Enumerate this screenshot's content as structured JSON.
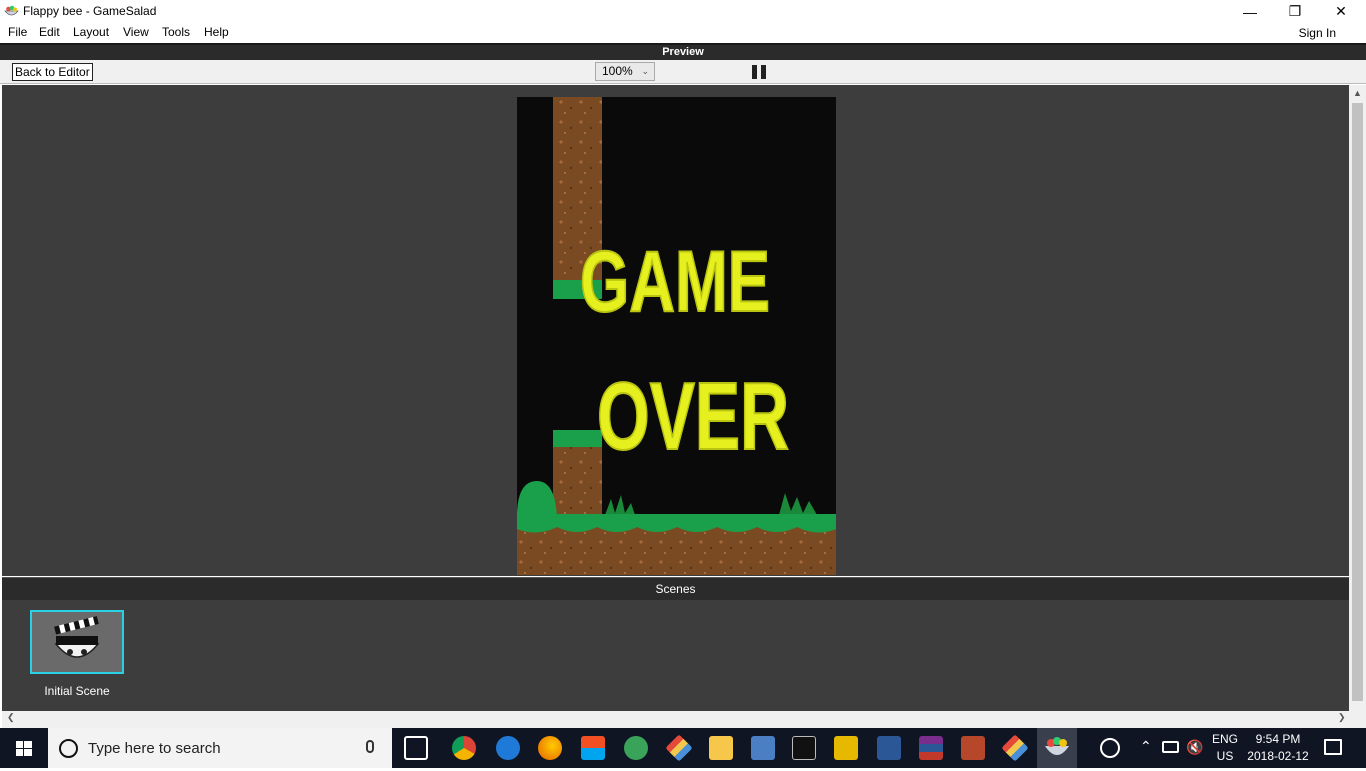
{
  "window": {
    "title": "Flappy bee - GameSalad",
    "minimize": "—",
    "restore": "❐",
    "close": "✕"
  },
  "menu": {
    "items": [
      "File",
      "Edit",
      "Layout",
      "View",
      "Tools",
      "Help"
    ],
    "sign_in": "Sign In"
  },
  "preview": {
    "header": "Preview",
    "back_label": "Back to Editor",
    "zoom": "100%",
    "zoom_chevron": "⌵"
  },
  "game": {
    "text_line1": "GAME",
    "text_line2": "OVER",
    "sky_color": "#0a0a0a",
    "text_color": "#e6f01e",
    "dirt_color": "#7a4a22",
    "grass_color": "#1aa04a"
  },
  "scenes": {
    "header": "Scenes",
    "items": [
      {
        "label": "Initial Scene",
        "selected": true
      }
    ],
    "selected_border": "#2ad0e6"
  },
  "scroll": {
    "up": "▲",
    "left": "❮",
    "right": "❯"
  },
  "taskbar": {
    "search_placeholder": "Type here to search",
    "lang_top": "ENG",
    "lang_bottom": "US",
    "time": "9:54 PM",
    "date": "2018-02-12"
  }
}
